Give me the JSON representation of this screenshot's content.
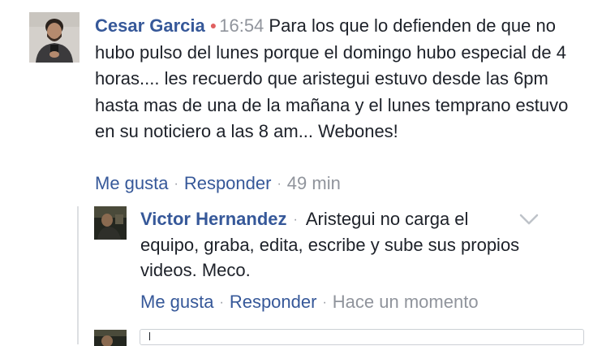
{
  "comment": {
    "author": "Cesar Garcia",
    "time": "16:54",
    "text": "Para los que lo defienden de que no hubo pulso del lunes porque el domingo hubo especial de 4 horas.... les recuerdo que aristegui estuvo desde las 6pm hasta mas de una de la mañana y el lunes temprano estuvo en su noticiero a las 8 am... Webones!",
    "actions": {
      "like": "Me gusta",
      "reply": "Responder",
      "age": "49 min"
    }
  },
  "reply": {
    "author": "Victor Hernandez",
    "text": "Aristegui no carga el equipo, graba, edita, escribe y sube sus propios videos. Meco.",
    "actions": {
      "like": "Me gusta",
      "reply": "Responder",
      "age": "Hace un momento"
    }
  },
  "colors": {
    "link": "#365899",
    "meta": "#90949c",
    "text": "#1d2129",
    "online_dot": "#e06060"
  }
}
